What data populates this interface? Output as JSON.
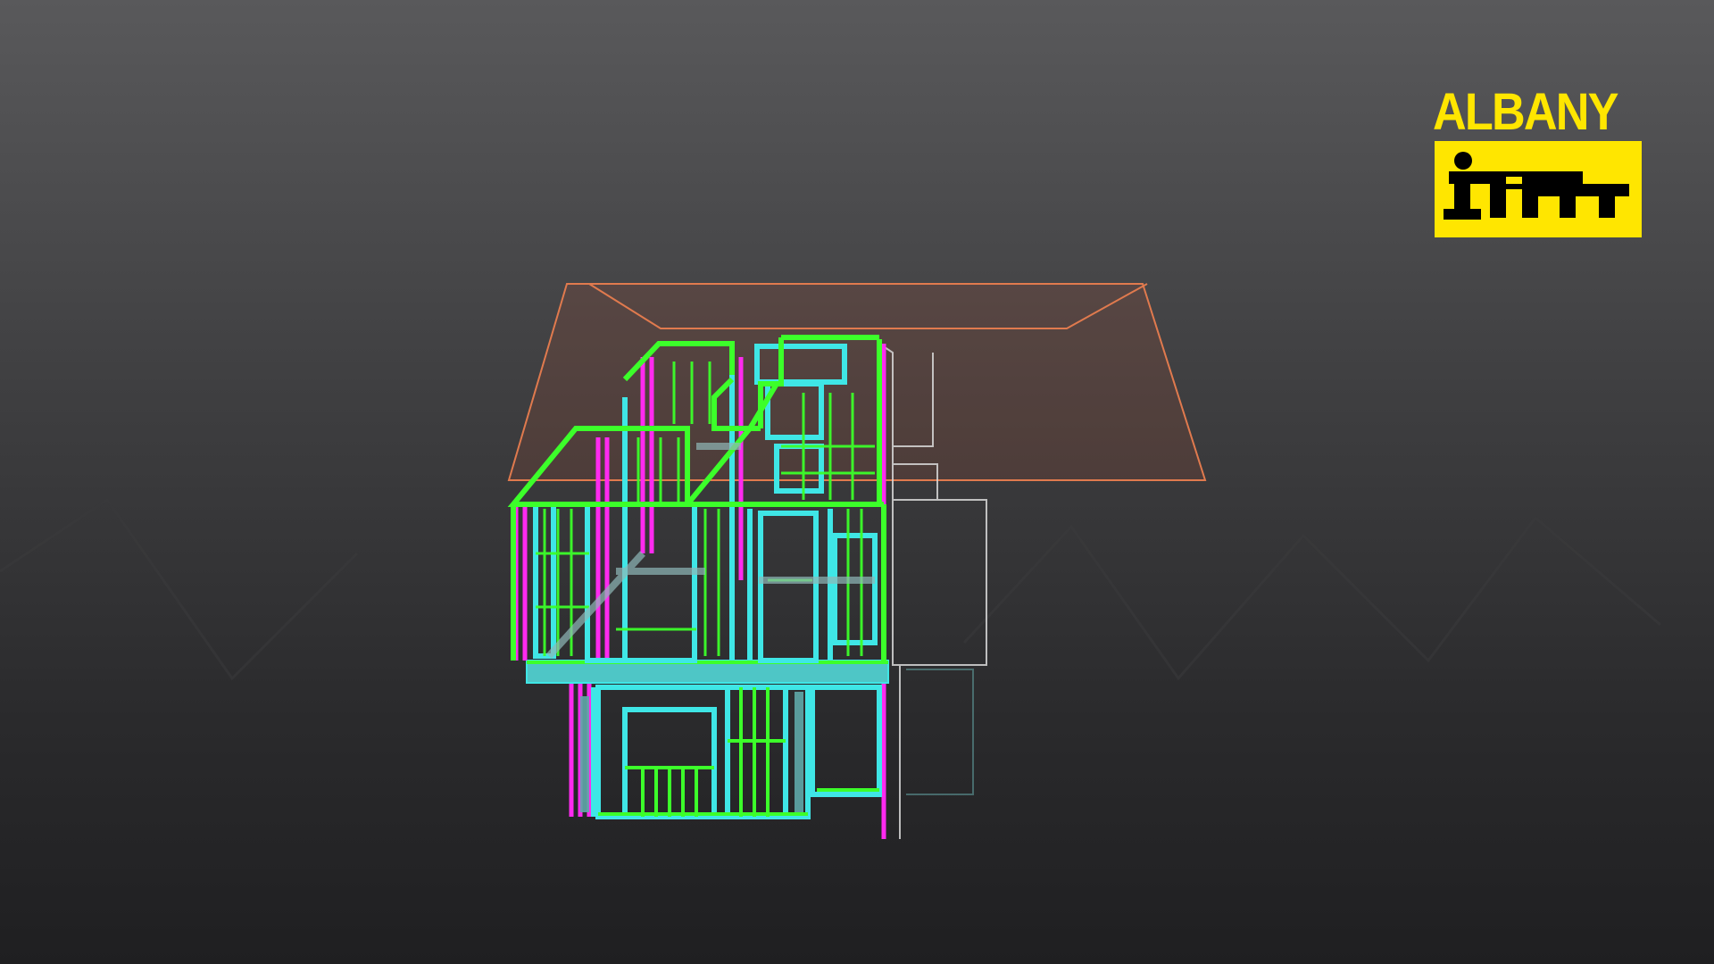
{
  "brand": {
    "wordmark": "ALBANY",
    "mark": "itm",
    "accent_color": "#ffe600"
  },
  "model": {
    "frame_colors": {
      "stud_green": "#3cff2a",
      "stud_cyan": "#3fe6e6",
      "stud_magenta": "#ff2af0",
      "roof_outline": "#e07a4e",
      "ghost_outline": "#d8d8d8"
    }
  }
}
